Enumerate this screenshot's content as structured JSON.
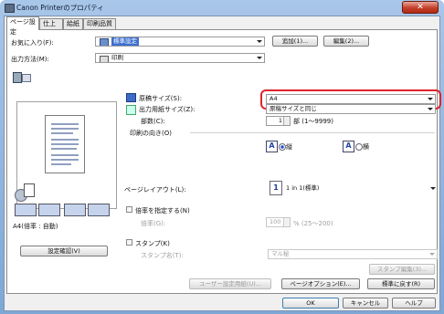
{
  "window": {
    "title": "Canon Printerのプロパティ",
    "close": "✕"
  },
  "tabs": [
    "ページ設定",
    "仕上げ",
    "給紙",
    "印刷品質"
  ],
  "favorites": {
    "label": "お気に入り(F):",
    "value": "標準設定",
    "add": "追加(1)...",
    "edit": "編集(2)..."
  },
  "output": {
    "label": "出力方法(M):",
    "value": "印刷"
  },
  "preview_caption": "A4(倍率 : 自動)",
  "confirm_button": "設定確認(V)",
  "paper": {
    "orig_label": "原稿サイズ(S):",
    "orig_value": "A4",
    "out_label": "出力用紙サイズ(Z):",
    "out_value": "原稿サイズと同じ",
    "copies_label": "部数(C):",
    "copies_value": "1",
    "copies_suffix": "部 (1〜9999)"
  },
  "orientation": {
    "label": "印刷の向き(O)",
    "portrait": "縦",
    "landscape": "横"
  },
  "layout": {
    "label": "ページレイアウト(L):",
    "icon_num": "1",
    "value": "1 in 1(標準)"
  },
  "scaling": {
    "check_label": "倍率を指定する(N)",
    "sub_label": "倍率(G):",
    "value": "100",
    "range": "% (25〜200)"
  },
  "stamp": {
    "check_label": "スタンプ(K)",
    "name_label": "スタンプ名(T):",
    "value": "マル秘",
    "edit": "スタンプ編集(3)..."
  },
  "bottom": {
    "user_settings": "ユーザー設定用紙(U)...",
    "page_options": "ページオプション(E)...",
    "restore": "標準に戻す(R)"
  },
  "dialog": {
    "ok": "OK",
    "cancel": "キャンセル",
    "help": "ヘルプ"
  },
  "colors": {
    "highlight": "#e0232e"
  }
}
